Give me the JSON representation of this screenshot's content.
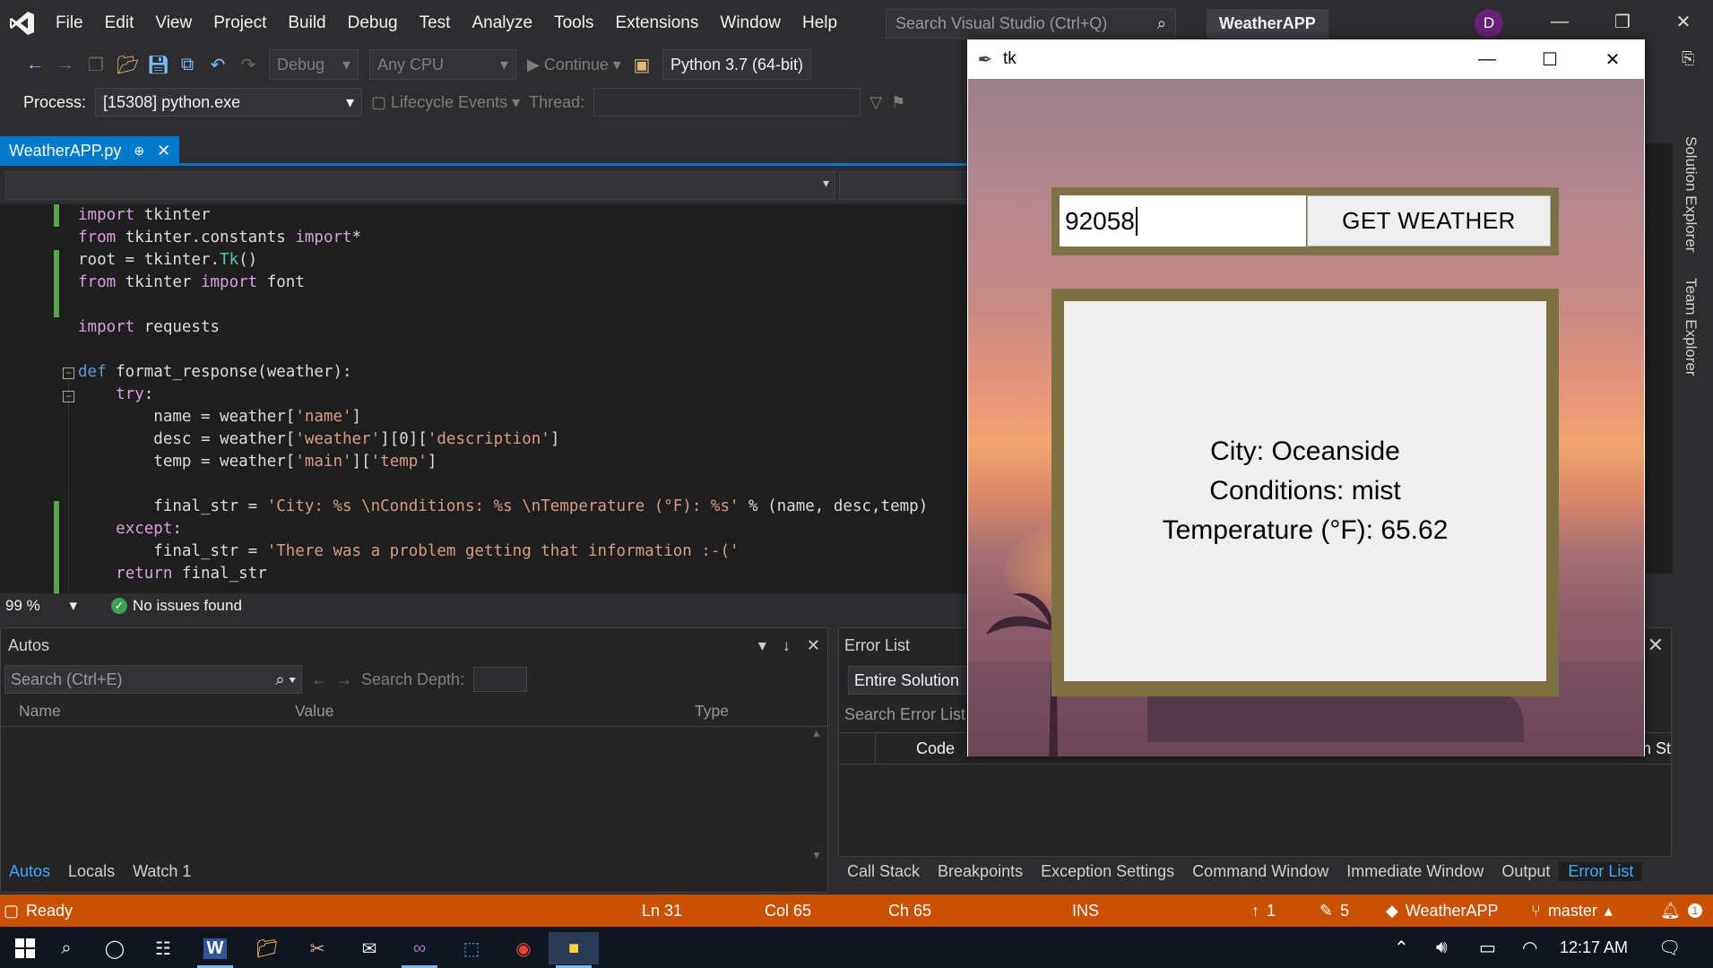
{
  "menubar": {
    "items": [
      "File",
      "Edit",
      "View",
      "Project",
      "Build",
      "Debug",
      "Test",
      "Analyze",
      "Tools",
      "Extensions",
      "Window",
      "Help"
    ],
    "search_placeholder": "Search Visual Studio (Ctrl+Q)",
    "solution_name": "WeatherAPP",
    "user_initial": "D"
  },
  "toolbar": {
    "configuration": "Debug",
    "platform": "Any CPU",
    "continue_label": "Continue",
    "environment": "Python 3.7 (64-bit)"
  },
  "debug_location": {
    "process_label": "Process:",
    "process_value": "[15308] python.exe",
    "lifecycle_label": "Lifecycle Events",
    "thread_label": "Thread:"
  },
  "editor": {
    "tab_title": "WeatherAPP.py",
    "zoom": "99 %",
    "issues": "No issues found"
  },
  "autos": {
    "title": "Autos",
    "search_placeholder": "Search (Ctrl+E)",
    "search_depth_label": "Search Depth:",
    "columns": [
      "Name",
      "Value",
      "Type"
    ],
    "tabs": [
      "Autos",
      "Locals",
      "Watch 1"
    ]
  },
  "error_list": {
    "title": "Error List",
    "scope": "Entire Solution",
    "search_placeholder": "Search Error List",
    "code_column": "Code",
    "partial_column": "n St"
  },
  "tool_tabs": [
    "Call Stack",
    "Breakpoints",
    "Exception Settings",
    "Command Window",
    "Immediate Window",
    "Output",
    "Error List"
  ],
  "side_tabs": [
    "Solution Explorer",
    "Team Explorer"
  ],
  "statusbar": {
    "ready": "Ready",
    "ln": "Ln 31",
    "col": "Col 65",
    "ch": "Ch 65",
    "mode": "INS",
    "up_count": "1",
    "edit_count": "5",
    "repo": "WeatherAPP",
    "branch": "master",
    "notifications": "1"
  },
  "taskbar": {
    "time": "12:17 AM"
  },
  "tk_window": {
    "title": "tk",
    "entry_value": "92058",
    "button_label": "GET WEATHER",
    "result_lines": [
      "City: Oceanside",
      "Conditions: mist",
      "Temperature (°F): 65.62"
    ]
  },
  "colors": {
    "accent": "#007acc",
    "statusbar": "#ca5100",
    "frame": "#7c7243",
    "link_blue": "#3ea8ff"
  }
}
